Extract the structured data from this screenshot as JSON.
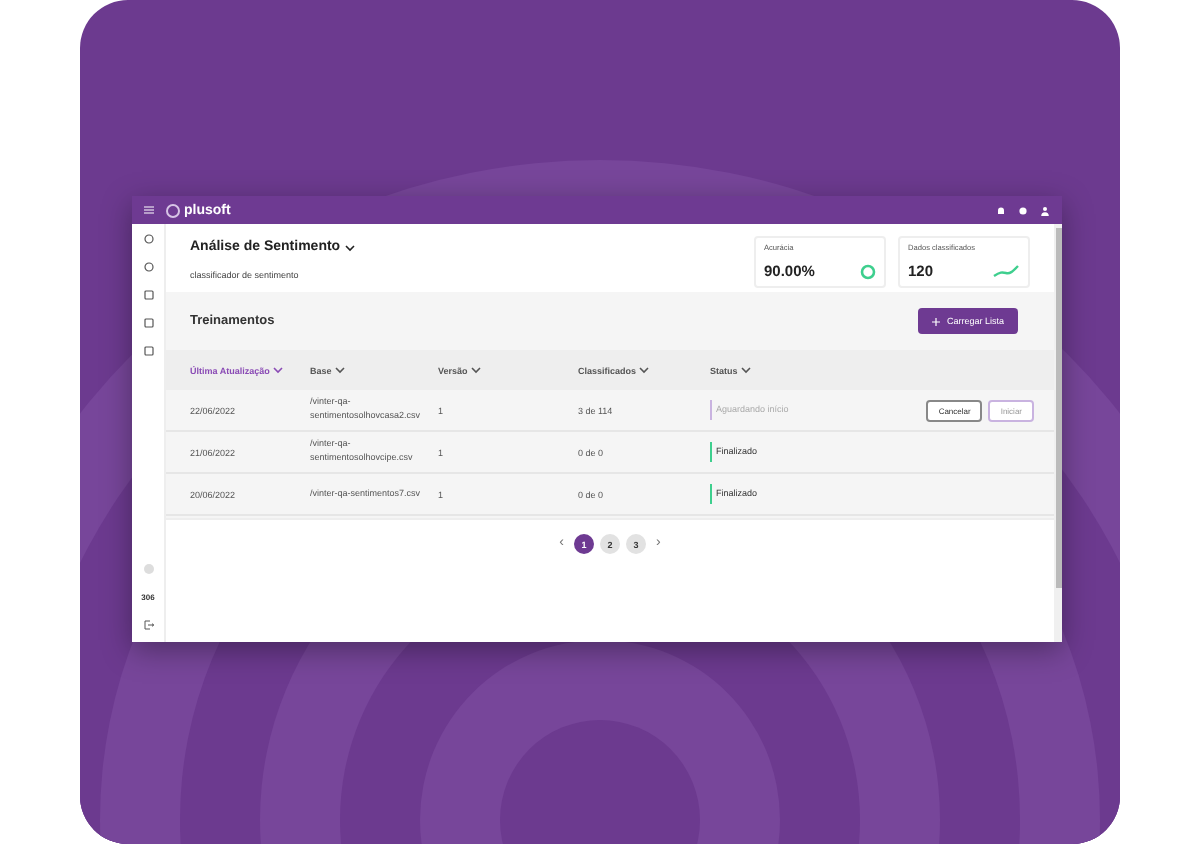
{
  "topbar": {
    "logo": "plusoft"
  },
  "sidebar": {
    "badge": "306"
  },
  "header": {
    "title": "Análise de Sentimento",
    "subtitle": "classificador de sentimento",
    "cards": [
      {
        "kind": "ring",
        "label": "Acurácia",
        "value": "90.00%"
      },
      {
        "kind": "trend",
        "label": "Dados classificados",
        "value": "120"
      }
    ]
  },
  "section": {
    "title": "Treinamentos",
    "button": "Carregar Lista"
  },
  "table": {
    "columns": [
      {
        "label": "Última Atualização",
        "selected": true
      },
      {
        "label": "Base",
        "selected": false
      },
      {
        "label": "Versão",
        "selected": false
      },
      {
        "label": "Classificados",
        "selected": false
      },
      {
        "label": "Status",
        "selected": false
      }
    ],
    "rows": [
      {
        "cells": [
          "22/06/2022",
          "/vinter-qa-sentimentosolhovcasa2.csv",
          "1",
          "3 de 114"
        ],
        "status": {
          "text": "Aguardando início",
          "kind": "pending",
          "color": "#c9b3e0"
        },
        "buttons": [
          {
            "label": "Cancelar",
            "kind": "secondary"
          },
          {
            "label": "Iniciar",
            "kind": "primary"
          }
        ]
      },
      {
        "cells": [
          "21/06/2022",
          "/vinter-qa-sentimentosolhovcipe.csv",
          "1",
          "0 de 0"
        ],
        "status": {
          "text": "Finalizado",
          "kind": "done",
          "color": "#3ecf8e"
        },
        "buttons": []
      },
      {
        "cells": [
          "20/06/2022",
          "/vinter-qa-sentimentos7.csv",
          "1",
          "0 de 0"
        ],
        "status": {
          "text": "Finalizado",
          "kind": "done",
          "color": "#3ecf8e"
        },
        "buttons": []
      }
    ]
  },
  "pagination": {
    "prev": "‹",
    "next": "›",
    "pages": [
      {
        "label": "1",
        "selected": true
      },
      {
        "label": "2",
        "selected": false
      },
      {
        "label": "3",
        "selected": false
      }
    ]
  }
}
